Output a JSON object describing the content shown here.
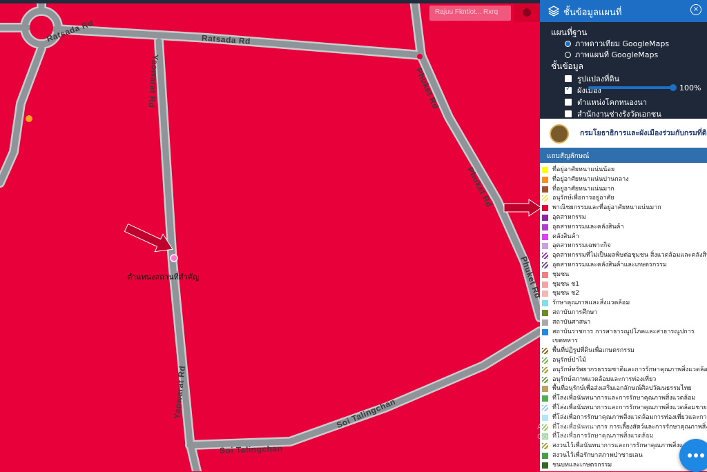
{
  "map": {
    "roads": [
      {
        "name": "Ratsada Rd"
      },
      {
        "name": "Ratsada Rd"
      },
      {
        "name": "Phuket Rd"
      },
      {
        "name": "Phuket Rd"
      },
      {
        "name": "Phuket Rd"
      },
      {
        "name": "Yaowarat Rd"
      },
      {
        "name": "Yaowarat Rd"
      },
      {
        "name": "Soi Talingchan"
      },
      {
        "name": "Soi Talingchan"
      }
    ],
    "place_label": "ตำแหน่งสถานที่สำคัญ",
    "search_placeholder": "Rajuu Fkntlot... Rxrq",
    "colors": {
      "zone": "#e8003a",
      "road": "#8f9499",
      "road_edge": "#c9cccf"
    }
  },
  "panel": {
    "title": "ชั้นข้อมูลแผนที่",
    "basemap_heading": "แผนที่ฐาน",
    "basemaps": [
      {
        "label": "ภาพดาวเทียม GoogleMaps",
        "selected": true
      },
      {
        "label": "ภาพแผนที่ GoogleMaps",
        "selected": false
      }
    ],
    "layers_heading": "ชั้นข้อมูล",
    "layers": [
      {
        "label": "รูปแปลงที่ดิน",
        "checked": false
      },
      {
        "label": "ผังเมือง",
        "checked": true
      },
      {
        "label": "ตำแหน่งโคกหนองนา",
        "checked": false
      },
      {
        "label": "สำนักงานช่างรังวัดเอกชน",
        "checked": false
      }
    ],
    "opacity": "100%"
  },
  "banner": {
    "text": "กรมโยธาธิการและผังเมืองร่วมกับกรมที่ดิน"
  },
  "legend": {
    "heading": "แถบสัญลักษณ์",
    "items": [
      {
        "label": "ที่อยู่อาศัยหนาแน่นน้อย",
        "color": "#ffff00",
        "hatch": false
      },
      {
        "label": "ที่อยู่อาศัยหนาแน่นปานกลาง",
        "color": "#ff8c1a",
        "hatch": false
      },
      {
        "label": "ที่อยู่อาศัยหนาแน่นมาก",
        "color": "#a0522d",
        "hatch": false
      },
      {
        "label": "อนุรักษ์เพื่อการอยู่อาศัย",
        "color": "#f5e642",
        "hatch": true
      },
      {
        "label": "พาณิชยกรรมและที่อยู่อาศัยหนาแน่นมาก",
        "color": "#e8003a",
        "hatch": false
      },
      {
        "label": "อุตสาหกรรม",
        "color": "#8e24aa",
        "hatch": false
      },
      {
        "label": "อุตสาหกรรมและคลังสินค้า",
        "color": "#b13bd4",
        "hatch": false
      },
      {
        "label": "คลังสินค้า",
        "color": "#e040fb",
        "hatch": false
      },
      {
        "label": "อุตสาหกรรมเฉพาะกิจ",
        "color": "#c9a0e6",
        "hatch": false
      },
      {
        "label": "อุตสาหกรรมที่ไม่เป็นมลพิษต่อชุมชน สิ่งแวดล้อมและคลังสินค้า",
        "color": "#9c27b0",
        "hatch": true
      },
      {
        "label": "อุตสาหกรรมและคลังสินค้าและเกษตรกรรม",
        "color": "#6a3d8f",
        "hatch": true
      },
      {
        "label": "ชุมชน",
        "color": "#f08080",
        "hatch": false
      },
      {
        "label": "ชุมชน ช1",
        "color": "#f4a3a3",
        "hatch": false
      },
      {
        "label": "ชุมชน ช2",
        "color": "#f7b5b5",
        "hatch": false
      },
      {
        "label": "รักษาคุณภาพและสิ่งแวดล้อม",
        "color": "#80deea",
        "hatch": false
      },
      {
        "label": "สถาบันการศึกษา",
        "color": "#6b8e23",
        "hatch": false
      },
      {
        "label": "สถาบันศาสนา",
        "color": "#a9a9a9",
        "hatch": false
      },
      {
        "label": "สถาบันราชการ การสาธารณูปโภคและสาธารณูปการ",
        "color": "#1e88e5",
        "hatch": false
      },
      {
        "label": "เขตทหาร",
        "color": "",
        "hatch": false
      },
      {
        "label": "พื้นที่ปฏิรูปที่ดินเพื่อเกษตรกรรม",
        "color": "#8b6914",
        "hatch": true
      },
      {
        "label": "อนุรักษ์ป่าไม้",
        "color": "#7cb342",
        "hatch": true
      },
      {
        "label": "อนุรักษ์ทรัพยากรธรรมชาติและการรักษาคุณภาพสิ่งแวดล้อม",
        "color": "#9e9d24",
        "hatch": true
      },
      {
        "label": "อนุรักษ์สภาพแวดล้อมและการท่องเที่ยว",
        "color": "#689f38",
        "hatch": true
      },
      {
        "label": "พื้นที่อนุรักษ์เพื่อส่งเสริมเอกลักษณ์ศิลปวัฒนธรรมไทย",
        "color": "#c0a060",
        "hatch": false
      },
      {
        "label": "ที่โล่งเพื่อนันทนาการและการรักษาคุณภาพสิ่งแวดล้อม",
        "color": "#4caf50",
        "hatch": false
      },
      {
        "label": "ที่โล่งเพื่อนันทนาการและการรักษาคุณภาพสิ่งแวดล้อมชายฝั่ง",
        "color": "#90caf9",
        "hatch": true
      },
      {
        "label": "ที่โล่งเพื่อการรักษาคุณภาพสิ่งแวดล้อมการท่องเที่ยวและการป",
        "color": "#b3e5fc",
        "hatch": false
      },
      {
        "label": "ที่โล่งเพื่อนันทนาการ การเลี้ยงสัตว์และการรักษาคุณภาพสิ่งแ",
        "color": "#8bc34a",
        "hatch": true
      },
      {
        "label": "ที่โล่งเพื่อการรักษาคุณภาพสิ่งแวดล้อม",
        "color": "#a5d6a7",
        "hatch": false
      },
      {
        "label": "สงวนไว้เพื่อนันทนาการและการรักษาคุณภาพสิ่งแวดล้",
        "color": "#9e9d24",
        "hatch": true
      },
      {
        "label": "สงวนไว้เพื่อรักษาสภาพป่าชายเลน",
        "color": "#43a047",
        "hatch": false
      },
      {
        "label": "ชนบทและเกษตรกรรม",
        "color": "#33691e",
        "hatch": false
      }
    ]
  },
  "watermark": {
    "line1": "Activate Windows",
    "line2": "Go to Settings to activate Windows."
  }
}
